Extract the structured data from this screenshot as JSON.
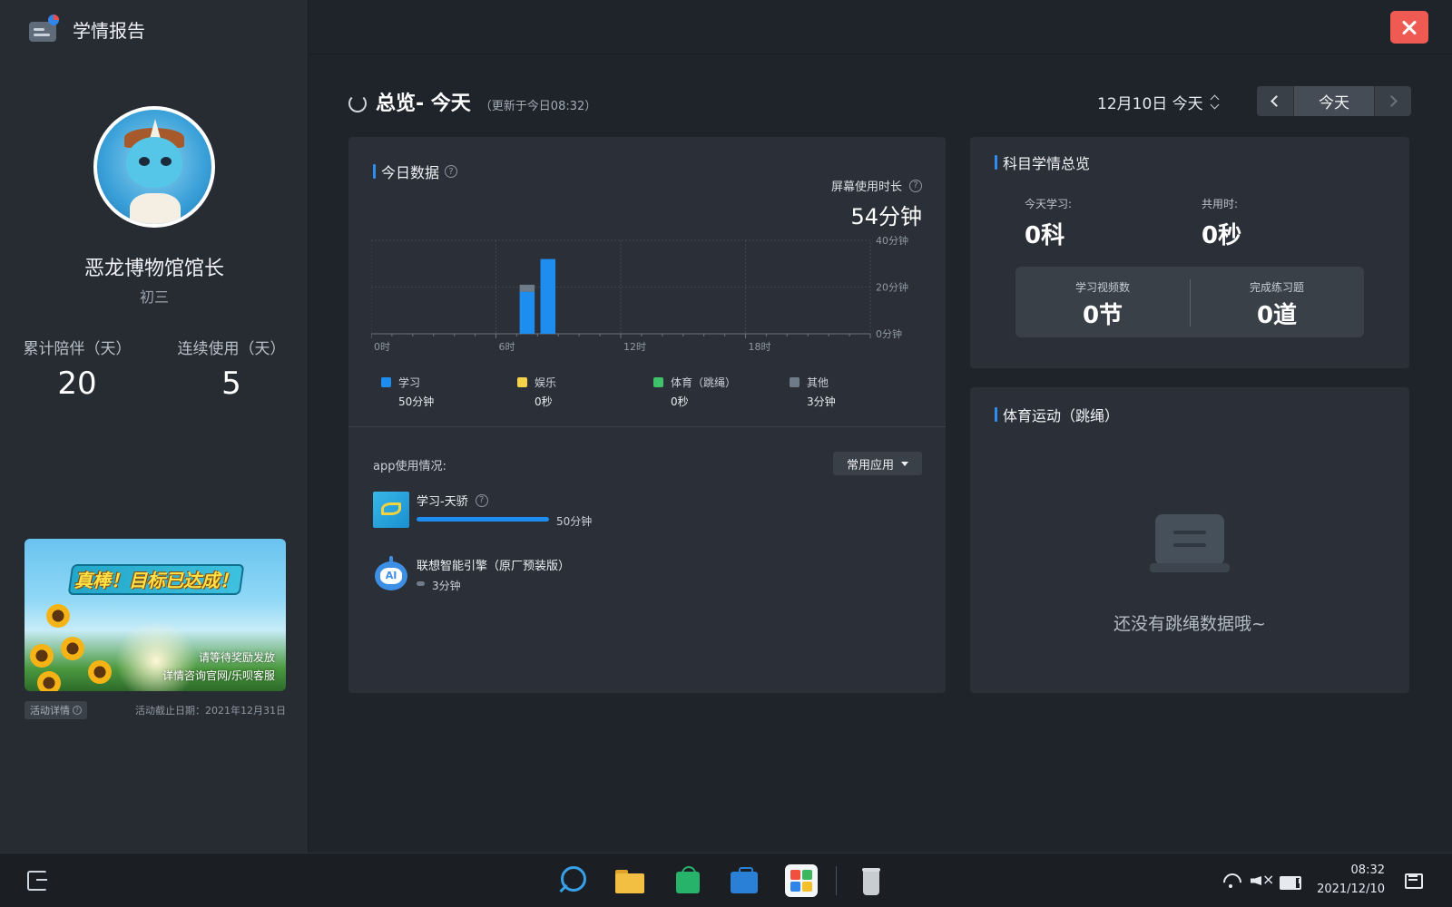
{
  "window": {
    "title": "学情报告"
  },
  "profile": {
    "nickname": "恶龙博物馆馆长",
    "grade": "初三",
    "stats": [
      {
        "label": "累计陪伴（天）",
        "value": "20"
      },
      {
        "label": "连续使用（天）",
        "value": "5"
      }
    ]
  },
  "promo": {
    "headline": "真棒！目标已达成！",
    "line1": "请等待奖励发放",
    "line2": "详情咨询官网/乐呗客服",
    "tag": "活动详情",
    "deadline": "活动截止日期：2021年12月31日"
  },
  "header": {
    "overview_title": "总览- 今天",
    "updated": "（更新于今日08:32）",
    "date_label": "12月10日 今天",
    "today_button": "今天"
  },
  "today_data": {
    "title": "今日数据",
    "screen_time_label": "屏幕使用时长",
    "screen_time_value": "54分钟",
    "legend": [
      {
        "name": "学习",
        "value": "50分钟",
        "color": "#1e8df0"
      },
      {
        "name": "娱乐",
        "value": "0秒",
        "color": "#f5d24a"
      },
      {
        "name": "体育（跳绳）",
        "value": "0秒",
        "color": "#3fc26a"
      },
      {
        "name": "其他",
        "value": "3分钟",
        "color": "#6f7b88"
      }
    ],
    "app_usage_label": "app使用情况:",
    "common_apps_label": "常用应用",
    "apps": [
      {
        "name": "学习-天骄",
        "time": "50分钟",
        "fraction": 0.96,
        "color": "#1e8df0",
        "icon": "tianjiao-app-icon"
      },
      {
        "name": "联想智能引擎（原厂预装版）",
        "time": "3分钟",
        "fraction": 0.06,
        "color": "#6f7b88",
        "icon": "ai-robot-icon"
      }
    ]
  },
  "chart_data": {
    "type": "bar",
    "stacked": true,
    "x_tick_labels": [
      "0时",
      "6时",
      "12时",
      "18时"
    ],
    "y_tick_labels": [
      "0分钟",
      "20分钟",
      "40分钟"
    ],
    "ylim": [
      0,
      40
    ],
    "xlim": [
      0,
      24
    ],
    "grid": true,
    "x": [
      7.5,
      8.5
    ],
    "series": [
      {
        "name": "学习",
        "color": "#1e8df0",
        "values": [
          18,
          32
        ]
      },
      {
        "name": "其他",
        "color": "#6f7b88",
        "values": [
          3,
          0
        ]
      }
    ]
  },
  "subject": {
    "title": "科目学情总览",
    "today_study_label": "今天学习:",
    "today_study_value": "0科",
    "total_time_label": "共用时:",
    "total_time_value": "0秒",
    "videos_label": "学习视频数",
    "videos_value": "0节",
    "exercises_label": "完成练习题",
    "exercises_value": "0道"
  },
  "sport": {
    "title": "体育运动（跳绳）",
    "empty_text": "还没有跳绳数据哦~"
  },
  "taskbar": {
    "time": "08:32",
    "date": "2021/12/10"
  }
}
